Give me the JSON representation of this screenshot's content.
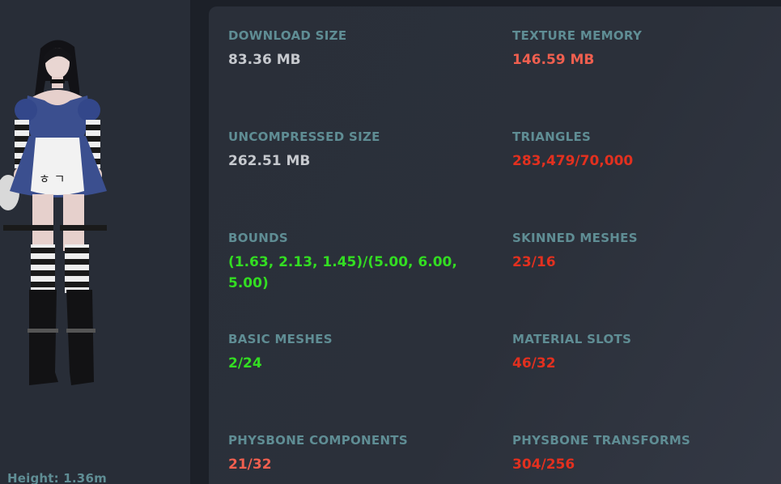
{
  "preview": {
    "height_label": "Height: 1.36m"
  },
  "stats": {
    "download_size": {
      "label": "DOWNLOAD SIZE",
      "value": "83.36 MB"
    },
    "texture_memory": {
      "label": "TEXTURE MEMORY",
      "value": "146.59 MB"
    },
    "uncompressed_size": {
      "label": "UNCOMPRESSED SIZE",
      "value": "262.51 MB"
    },
    "triangles": {
      "label": "TRIANGLES",
      "value": "283,479/70,000"
    },
    "bounds": {
      "label": "BOUNDS",
      "value": "(1.63, 2.13, 1.45)/(5.00, 6.00, 5.00)"
    },
    "skinned_meshes": {
      "label": "SKINNED MESHES",
      "value": "23/16"
    },
    "basic_meshes": {
      "label": "BASIC MESHES",
      "value": "2/24"
    },
    "material_slots": {
      "label": "MATERIAL SLOTS",
      "value": "46/32"
    },
    "physbone_components": {
      "label": "PHYSBONE COMPONENTS",
      "value": "21/32"
    },
    "physbone_transforms": {
      "label": "PHYSBONE TRANSFORMS",
      "value": "304/256"
    }
  },
  "colors": {
    "label": "#5f8d94",
    "neutral": "#c6c9ce",
    "warning": "#ef5f4f",
    "over_limit": "#e2301f",
    "ok": "#33dd22"
  }
}
